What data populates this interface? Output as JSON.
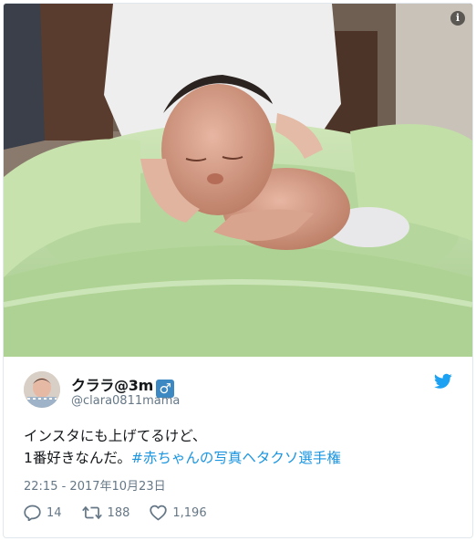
{
  "photo": {
    "alt": ""
  },
  "user": {
    "display_name": "クララ@3m",
    "gender_symbol": "♂",
    "handle": "@clara0811mama"
  },
  "tweet": {
    "line1": "インスタにも上げてるけど、",
    "line2_text": "1番好きなんだ。",
    "line2_hashtag": "#赤ちゃんの写真ヘタクソ選手権",
    "timestamp": "22:15 - 2017年10月23日"
  },
  "actions": {
    "replies": "14",
    "retweets": "188",
    "likes": "1,196"
  },
  "colors": {
    "accent": "#1da1f2",
    "hashtag": "#1b95e0",
    "muted": "#657786"
  },
  "icons": {
    "info": "info-icon",
    "bird": "twitter-bird-icon",
    "reply": "reply-icon",
    "retweet": "retweet-icon",
    "like": "heart-icon"
  }
}
